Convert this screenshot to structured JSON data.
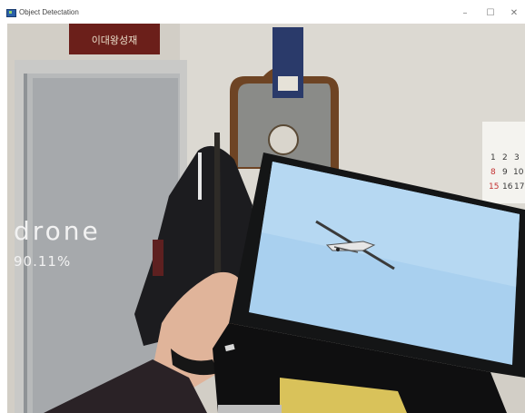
{
  "window": {
    "title": "Object Detectation",
    "buttons": {
      "minimize": "–",
      "maximize": "☐",
      "close": "✕"
    }
  },
  "detection": {
    "label": "drone",
    "confidence": "90.11%"
  },
  "scene": {
    "sign_text": "이대왕성재",
    "calendar_numbers": [
      "1",
      "2",
      "3",
      "8",
      "9",
      "10",
      "15",
      "16",
      "17"
    ]
  }
}
